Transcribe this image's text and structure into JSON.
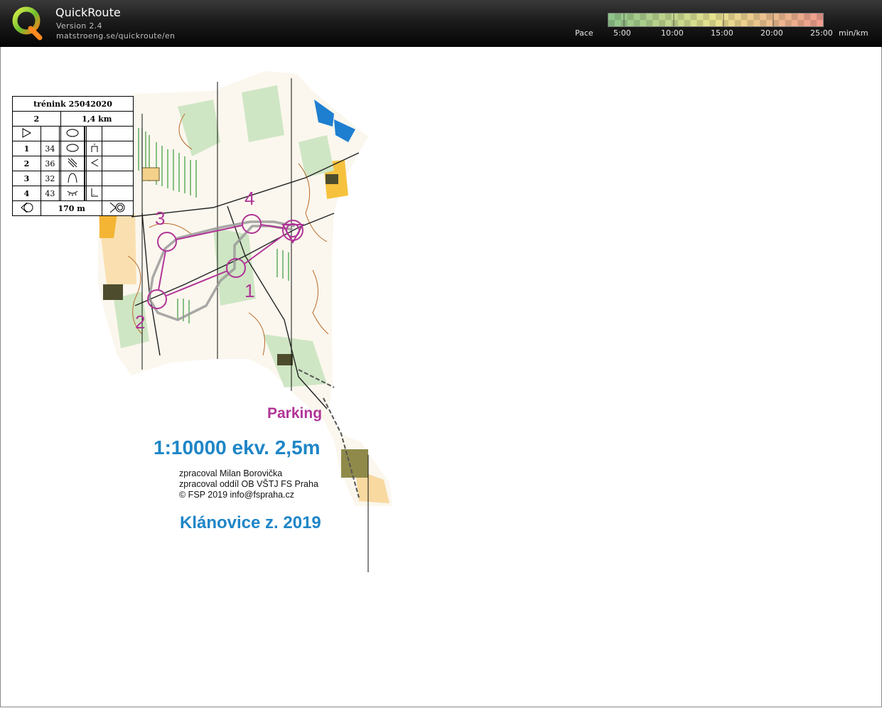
{
  "app": {
    "title": "QuickRoute",
    "version": "Version 2.4",
    "url": "matstroeng.se/quickroute/en"
  },
  "pace": {
    "label": "Pace",
    "ticks": [
      "5:00",
      "10:00",
      "15:00",
      "20:00",
      "25:00"
    ],
    "unit": "min/km",
    "colors": {
      "fast": "#8fc48a",
      "mid": "#e9e38f",
      "slow": "#ef9d8d"
    }
  },
  "control_card": {
    "title": "trénink 25042020",
    "course": "2",
    "length": "1,4 km",
    "rows": [
      {
        "num": "1",
        "code": "34"
      },
      {
        "num": "2",
        "code": "36"
      },
      {
        "num": "3",
        "code": "32"
      },
      {
        "num": "4",
        "code": "43"
      }
    ],
    "finish_distance": "170 m"
  },
  "map": {
    "control_labels": [
      "1",
      "2",
      "3",
      "4"
    ],
    "parking": "Parking",
    "scale_line": "1:10000 ekv. 2,5m",
    "credits": [
      "zpracoval Milan Borovička",
      "zpracoval oddíl OB VŠTJ FS Praha",
      "© FSP 2019  info@fspraha.cz"
    ],
    "map_title": "Klánovice z. 2019",
    "colors": {
      "course": "#b03597",
      "route": "#9a9a9a",
      "text_blue": "#1f86c7"
    }
  }
}
